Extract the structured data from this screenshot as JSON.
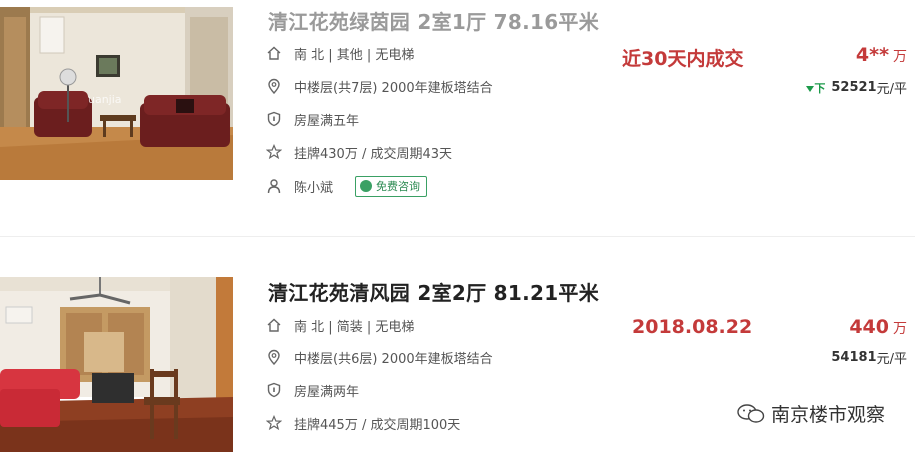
{
  "listings": [
    {
      "title": "清江花苑绿茵园 2室1厅 78.16平米",
      "orientation": "南 北 | 其他 | 无电梯",
      "floor": "中楼层(共7层) 2000年建板塔结合",
      "tax": "房屋满五年",
      "listing_info": "挂牌430万 / 成交周期43天",
      "agent": "陈小斌",
      "consult_label": "免费咨询",
      "deal_date": "近30天内成交",
      "price": "4**",
      "price_unit": "万",
      "unit_price_badge": "下",
      "unit_price": "52521",
      "unit_price_unit": "元/平",
      "photo_watermark": "uanjia"
    },
    {
      "title": "清江花苑清风园 2室2厅 81.21平米",
      "orientation": "南 北 | 简装 | 无电梯",
      "floor": "中楼层(共6层) 2000年建板塔结合",
      "tax": "房屋满两年",
      "listing_info": "挂牌445万 / 成交周期100天",
      "deal_date": "2018.08.22",
      "price": "440",
      "price_unit": "万",
      "unit_price": "54181",
      "unit_price_unit": "元/平"
    }
  ],
  "watermark": {
    "text": "南京楼市观察"
  },
  "colors": {
    "accent_red": "#c43a3a",
    "consult_green": "#3aa064",
    "down_green": "#1c9a4a"
  }
}
